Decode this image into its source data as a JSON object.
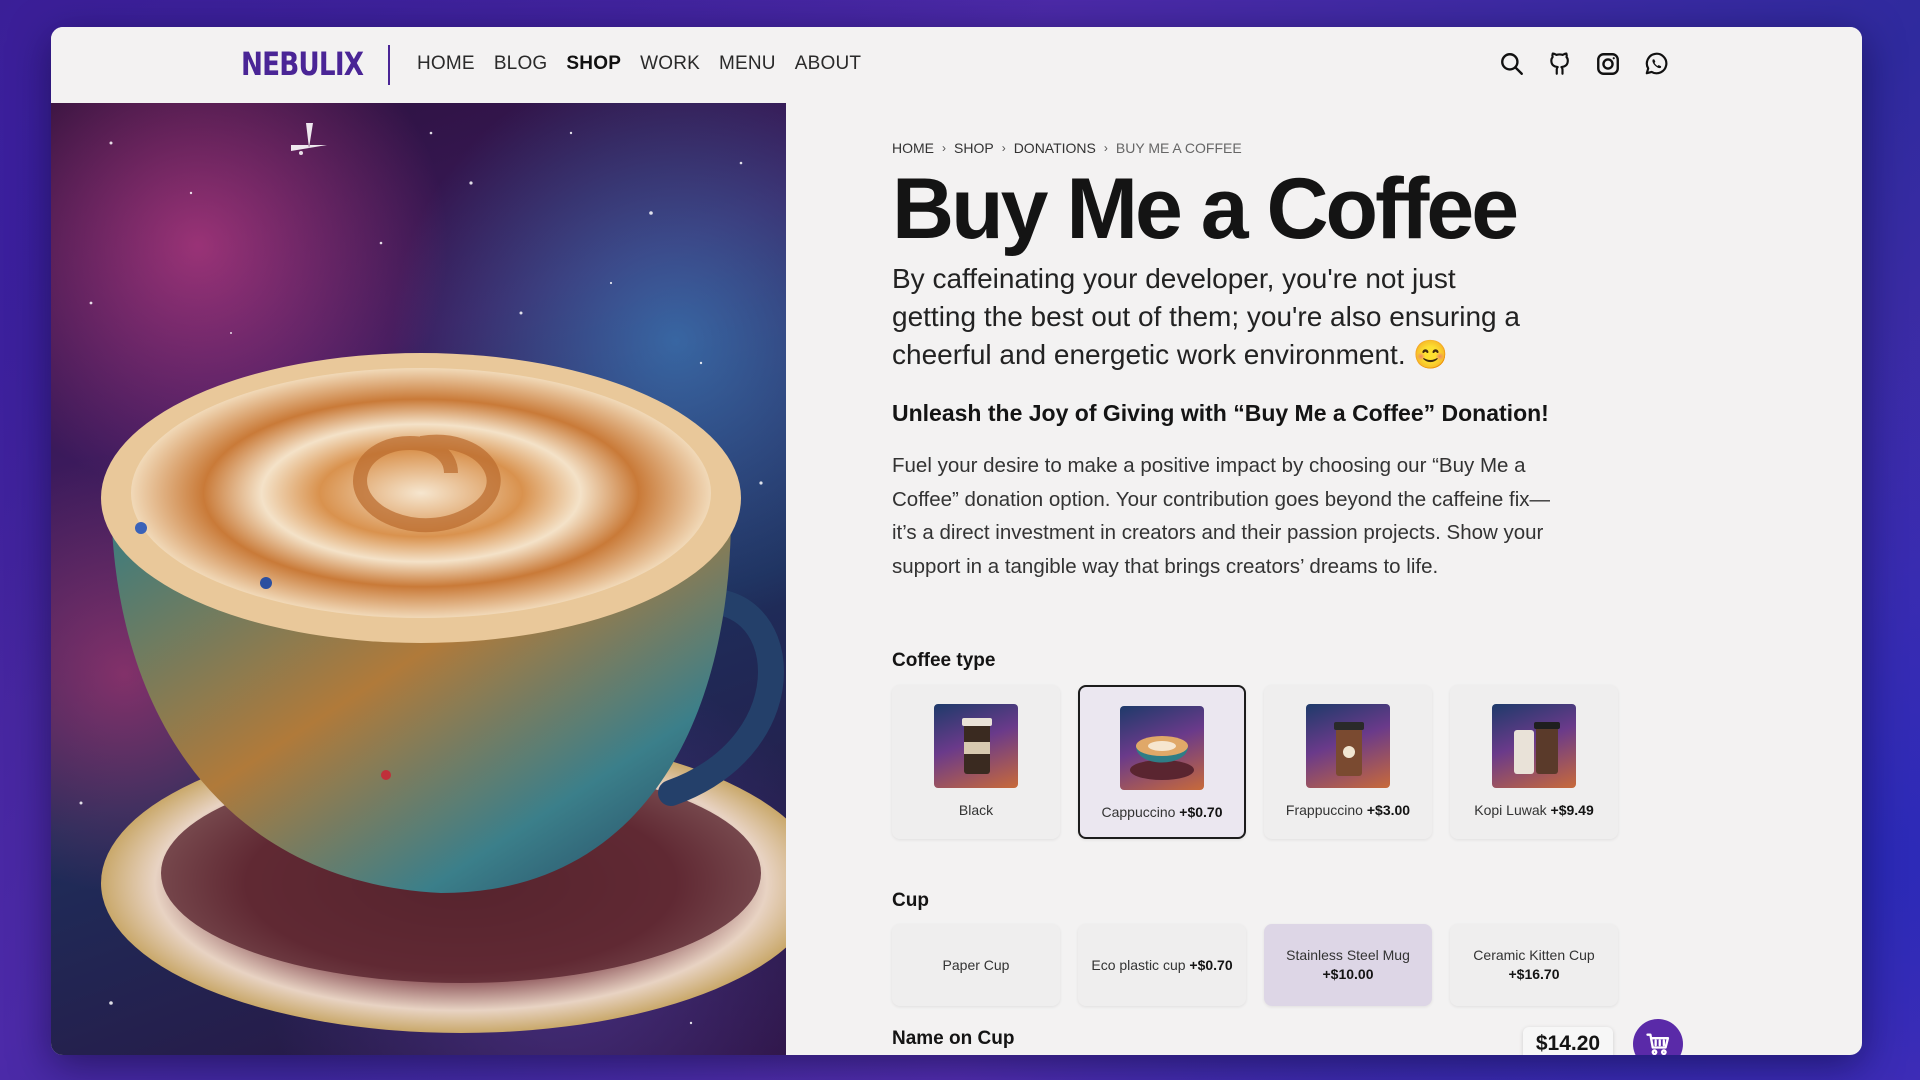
{
  "brand": {
    "logo": "NEBULIX",
    "accent": "#4a2596",
    "cart_color": "#5a2aa8"
  },
  "nav": [
    {
      "label": "HOME",
      "active": false
    },
    {
      "label": "BLOG",
      "active": false
    },
    {
      "label": "SHOP",
      "active": true
    },
    {
      "label": "WORK",
      "active": false
    },
    {
      "label": "MENU",
      "active": false
    },
    {
      "label": "ABOUT",
      "active": false
    }
  ],
  "header_icons": [
    "search-icon",
    "github-icon",
    "instagram-icon",
    "whatsapp-icon"
  ],
  "breadcrumb": [
    "HOME",
    "SHOP",
    "DONATIONS",
    "BUY ME A COFFEE"
  ],
  "product": {
    "title": "Buy Me a Coffee",
    "lead": "By caffeinating your developer, you're not just getting the best out of them; you're also ensuring a cheerful and energetic work environment. 😊",
    "subhead": "Unleash the Joy of Giving with “Buy Me a Coffee” Donation!",
    "body": "Fuel your desire to make a positive impact by choosing our “Buy Me a Coffee” donation option. Your contribution goes beyond the caffeine fix—it’s a direct investment in creators and their passion projects. Show your support in a tangible way that brings creators’ dreams to life."
  },
  "coffee_type": {
    "label": "Coffee type",
    "options": [
      {
        "name": "Black",
        "price": "",
        "selected": false
      },
      {
        "name": "Cappuccino",
        "price": "+$0.70",
        "selected": true
      },
      {
        "name": "Frappuccino",
        "price": "+$3.00",
        "selected": false
      },
      {
        "name": "Kopi Luwak",
        "price": "+$9.49",
        "selected": false
      }
    ]
  },
  "cup": {
    "label": "Cup",
    "options": [
      {
        "name": "Paper Cup",
        "price": "",
        "selected": false
      },
      {
        "name": "Eco plastic cup",
        "price": "+$0.70",
        "selected": false
      },
      {
        "name": "Stainless Steel Mug",
        "price": "+$10.00",
        "selected": true
      },
      {
        "name": "Ceramic Kitten Cup",
        "price": "+$16.70",
        "selected": false
      }
    ]
  },
  "name_on_cup": {
    "label": "Name on Cup",
    "value": ""
  },
  "total": {
    "price": "$14.20"
  }
}
